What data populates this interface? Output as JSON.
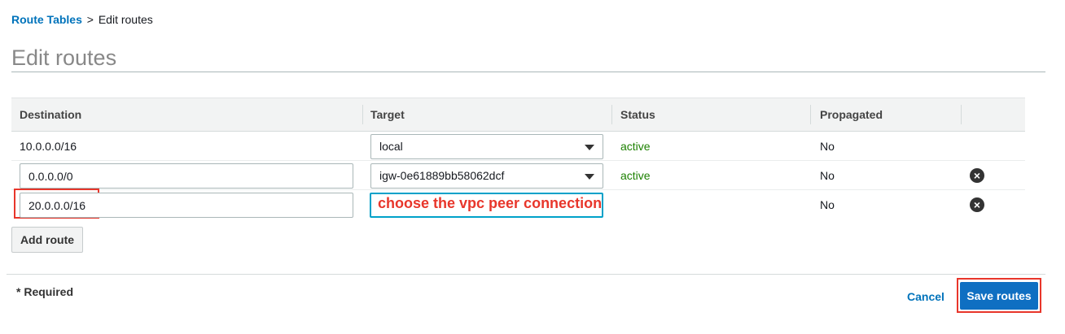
{
  "breadcrumb": {
    "link": "Route Tables",
    "separator": ">",
    "current": "Edit routes"
  },
  "page_title": "Edit routes",
  "table": {
    "headers": [
      "Destination",
      "Target",
      "Status",
      "Propagated"
    ],
    "rows": [
      {
        "destination": "10.0.0.0/16",
        "target": "local",
        "status": "active",
        "propagated": "No"
      },
      {
        "destination": "0.0.0.0/0",
        "target": "igw-0e61889bb58062dcf",
        "status": "active",
        "propagated": "No"
      },
      {
        "destination": "20.0.0.0/16",
        "target": "",
        "status": "",
        "propagated": "No"
      }
    ]
  },
  "annotation": "choose the vpc peer connection",
  "add_route_label": "Add route",
  "footer": {
    "required": "* Required",
    "cancel": "Cancel",
    "save": "Save routes"
  },
  "colors": {
    "link": "#0073bb",
    "active": "#1d8102",
    "annotation": "#e8362b",
    "primary": "#0f6fc2"
  }
}
